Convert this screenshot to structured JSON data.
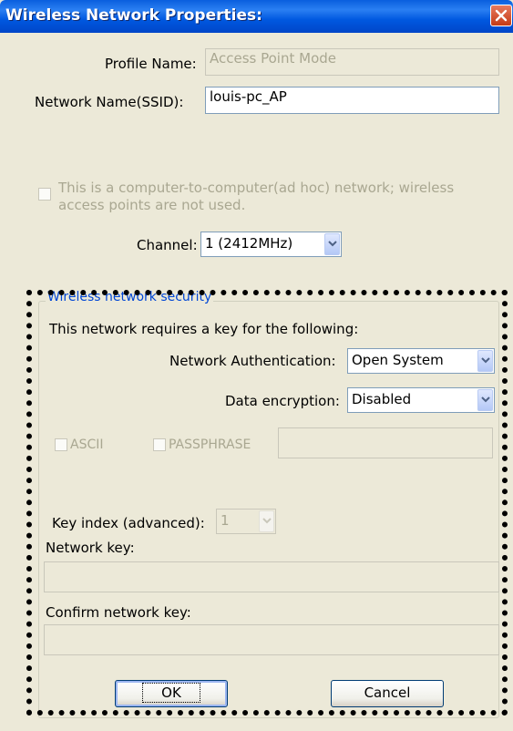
{
  "window": {
    "title": "Wireless Network Properties:"
  },
  "profile": {
    "label": "Profile Name:",
    "value": "Access Point Mode"
  },
  "ssid": {
    "label": "Network Name(SSID):",
    "value": "louis-pc_AP"
  },
  "adhoc": {
    "line1": "This is a computer-to-computer(ad hoc) network; wireless",
    "line2": "access points are not used.",
    "checked": false
  },
  "channel": {
    "label": "Channel:",
    "value": "1  (2412MHz)"
  },
  "security": {
    "group_title": "Wireless network security",
    "intro": "This network requires a key for the following:",
    "auth_label": "Network Authentication:",
    "auth_value": "Open System",
    "encryption_label": "Data encryption:",
    "encryption_value": "Disabled",
    "ascii_label": "ASCII",
    "passphrase_label": "PASSPHRASE",
    "key_index_label": "Key index (advanced):",
    "key_index_value": "1",
    "network_key_label": "Network key:",
    "confirm_key_label": "Confirm network key:"
  },
  "buttons": {
    "ok_label": "OK",
    "cancel_label": "Cancel"
  },
  "icons": {
    "close": "close-icon",
    "dropdown": "chevron-down-icon"
  }
}
